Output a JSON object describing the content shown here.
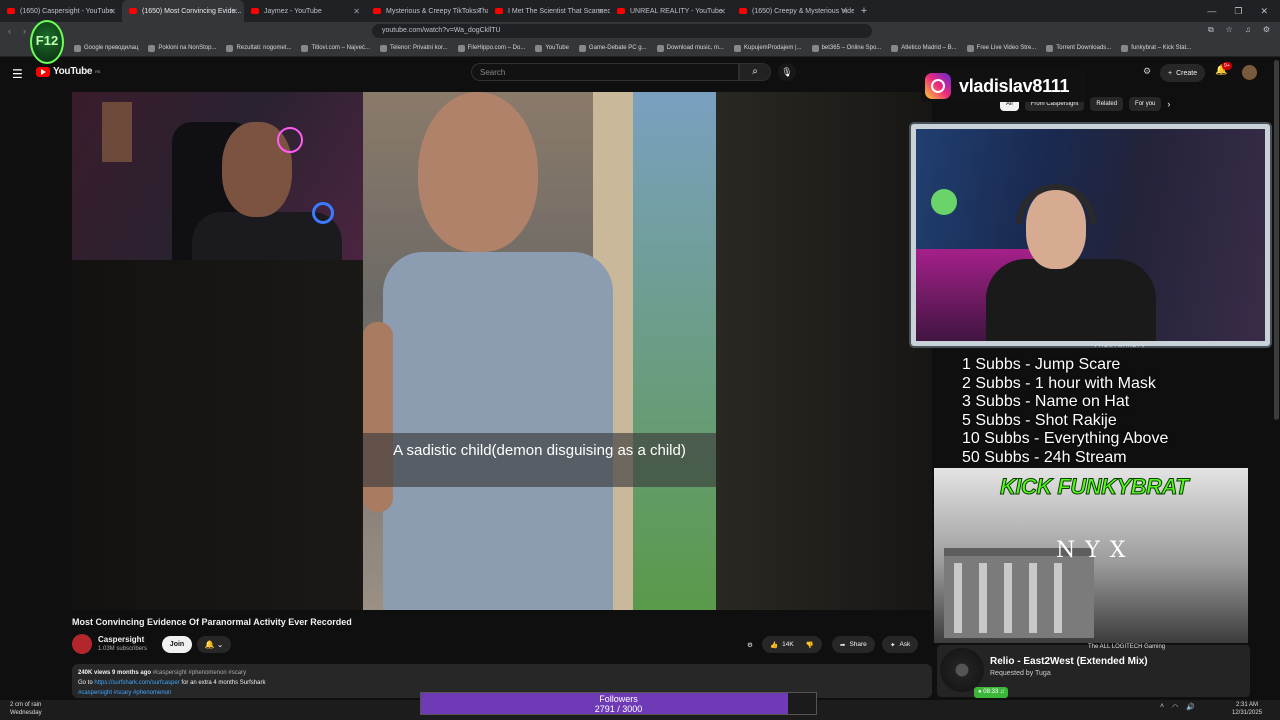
{
  "browser": {
    "tabs": [
      {
        "title": "(1650) Caspersight - YouTube",
        "active": false
      },
      {
        "title": "(1650) Most Convincing Evide...",
        "active": true
      },
      {
        "title": "Jaymez - YouTube",
        "active": false
      },
      {
        "title": "Mysterious & Creepy TikToks That'll...",
        "active": false
      },
      {
        "title": "I Met The Scientist That Scanned Bri...",
        "active": false
      },
      {
        "title": "UNREAL REALITY - YouTube",
        "active": false
      },
      {
        "title": "(1650) Creepy & Mysterious Videos I...",
        "active": false
      }
    ],
    "url": "youtube.com/watch?v=Wa_dogCkllTU",
    "bookmarks": [
      "Google преводилац",
      "Pokloni na NonStop...",
      "Rezultati: nogomet...",
      "Titlovi.com – Najveć...",
      "Telenor: Privatni kor...",
      "FileHippo.com – Do...",
      "YouTube",
      "Game-Debate PC g...",
      "Download music, m...",
      "KupujemProdajem |...",
      "bet365 – Online Spo...",
      "Atletico Madrid – B...",
      "Free Live Video Stre...",
      "Torrent Downloads...",
      "funkybrat – Kick Stat..."
    ]
  },
  "youtube": {
    "logo_text": "YouTube",
    "region": "RS",
    "search_placeholder": "Search",
    "create_label": "Create",
    "notif_count": "9+",
    "chips": [
      "All",
      "From Caspersight",
      "Related",
      "For you"
    ]
  },
  "video": {
    "subtitle": "A sadistic child(demon disguising as a child)",
    "title": "Most Convincing Evidence Of Paranormal Activity Ever Recorded",
    "channel": "Caspersight",
    "subscribers": "1.03M subscribers",
    "join_label": "Join",
    "likes": "14K",
    "share_label": "Share",
    "ask_label": "Ask",
    "views_line": "240K views  9 months ago",
    "hashtags_top": "#caspersight #phenomenon #scary",
    "desc_prefix": "Go to",
    "desc_link": "https://surfshark.com/surfcasper",
    "desc_suffix": "for an extra 4 months Surfshark",
    "hashtags_bottom": "#caspersight #scary #phenomenon"
  },
  "overlay": {
    "instagram_handle": "vladislav8111",
    "frame_tag": "· FROSTMARETV ·",
    "sub_goals": [
      "1 Subbs - Jump Scare",
      "2 Subbs - 1 hour with Mask",
      "3 Subbs - Name on Hat",
      "5 Subbs - Shot Rakije",
      "10 Subbs - Everything Above",
      "50 Subbs - 24h Stream"
    ],
    "kick_title": "KICK FUNKYBRAT",
    "nyx_text": "NYX",
    "song_title": "Relio - East2West (Extended Mix)",
    "song_requested": "Requested by Tuga",
    "song_time": "08:33",
    "rec_channel": "The ALL LOGITECH Gaming",
    "followers_label": "Followers",
    "followers_value": "2791 / 3000",
    "followers_fraction": 0.93
  },
  "taskbar": {
    "weather": "2 cm of rain",
    "day": "Wednesday",
    "time": "2:31 AM",
    "date": "12/31/2025"
  }
}
